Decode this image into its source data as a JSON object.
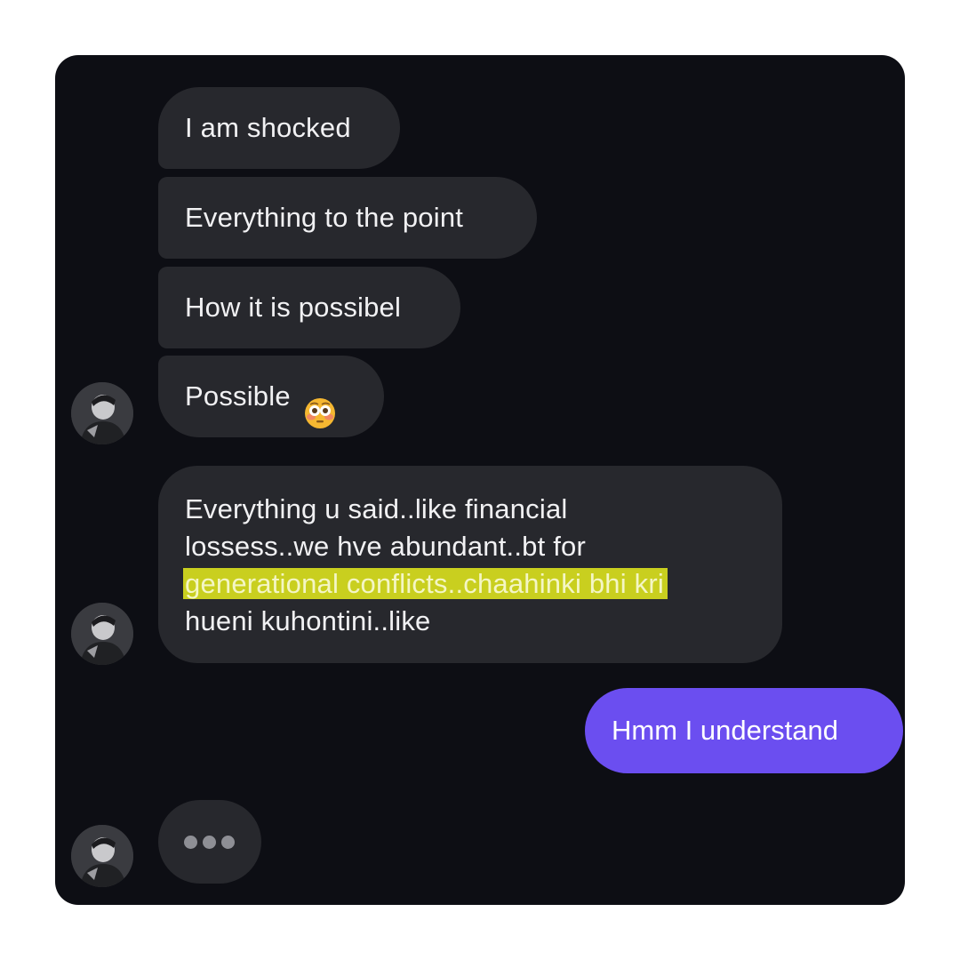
{
  "conversation": {
    "messages": [
      {
        "sender": "other",
        "text": "I am shocked"
      },
      {
        "sender": "other",
        "text": "Everything to the point"
      },
      {
        "sender": "other",
        "text": "How it is possibel"
      },
      {
        "sender": "other",
        "text": "Possible",
        "emoji": "flushed-face"
      },
      {
        "sender": "other",
        "line1": "Everything u said..like financial",
        "line2": "lossess..we hve abundant..bt for",
        "highlighted": "generational conflicts..chaahinki bhi kri",
        "line4": "hueni kuhontini..like"
      },
      {
        "sender": "me",
        "text": "Hmm I understand"
      }
    ],
    "typing_indicator": "..."
  },
  "colors": {
    "background": "#0d0e14",
    "incoming_bubble": "#27282d",
    "outgoing_bubble": "#6b4ef0",
    "highlight": "#c9cf1f"
  }
}
